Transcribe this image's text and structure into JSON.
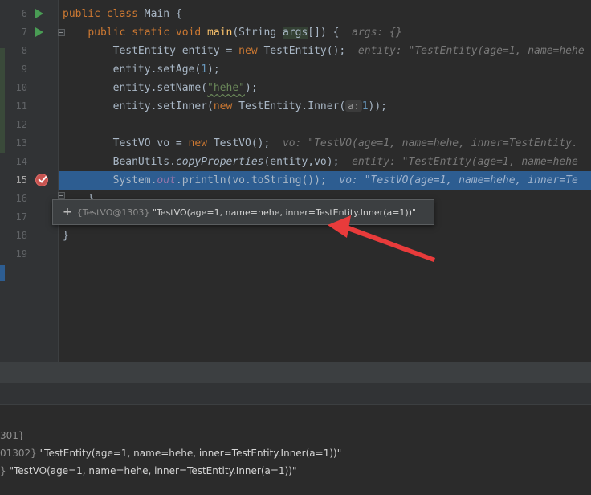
{
  "gutter": {
    "line_numbers": [
      "6",
      "7",
      "8",
      "9",
      "10",
      "11",
      "12",
      "13",
      "14",
      "15",
      "16",
      "17",
      "18",
      "19"
    ],
    "active_line": "15"
  },
  "code": {
    "l6": {
      "kw1": "public",
      "kw2": "class",
      "name": "Main",
      "brace": "{"
    },
    "l7": {
      "kw1": "public",
      "kw2": "static",
      "kw3": "void",
      "method": "main",
      "p_open": "(String ",
      "param": "args",
      "p_close": "[]) {",
      "inline": "args: {}"
    },
    "l8": {
      "type": "TestEntity entity = ",
      "kw": "new",
      "rest": " TestEntity();",
      "inline": "entity: \"TestEntity(age=1, name=hehe"
    },
    "l9": {
      "pre": "entity.setAge(",
      "num": "1",
      "post": ");"
    },
    "l10": {
      "pre": "entity.setName(",
      "str": "\"hehe\"",
      "post": ");"
    },
    "l11": {
      "pre": "entity.setInner(",
      "kw": "new",
      "mid": " TestEntity.Inner(",
      "hint": "a:",
      "num": "1",
      "post": "));"
    },
    "l13": {
      "type": "TestVO vo = ",
      "kw": "new",
      "rest": " TestVO();",
      "inline": "vo: \"TestVO(age=1, name=hehe, inner=TestEntity."
    },
    "l14": {
      "pre": "BeanUtils.",
      "call": "copyProperties",
      "post": "(entity,vo);",
      "inline": "entity: \"TestEntity(age=1, name=hehe"
    },
    "l15": {
      "pre": "System.",
      "field": "out",
      "post": ".println(vo.toString());",
      "inline": "vo: \"TestVO(age=1, name=hehe, inner=Te"
    },
    "l16": {
      "text": "}"
    },
    "l18": {
      "text": "}"
    }
  },
  "tooltip": {
    "plus": "+",
    "object_id": "{TestVO@1303}",
    "value": "\"TestVO(age=1, name=hehe, inner=TestEntity.Inner(a=1))\""
  },
  "variables": [
    {
      "id": "301}",
      "value": ""
    },
    {
      "id": "01302}",
      "value": "\"TestEntity(age=1, name=hehe, inner=TestEntity.Inner(a=1))\""
    },
    {
      "id": "}",
      "value": "\"TestVO(age=1, name=hehe, inner=TestEntity.Inner(a=1))\""
    }
  ],
  "colors": {
    "editor_bg": "#2b2b2b",
    "selection": "#2d5d91",
    "keyword": "#cc7832",
    "method": "#ffc66d",
    "number": "#6897bb",
    "string": "#6a8759",
    "arrow": "#e83b3b",
    "breakpoint": "#c75450",
    "run_icon": "#499c54"
  }
}
